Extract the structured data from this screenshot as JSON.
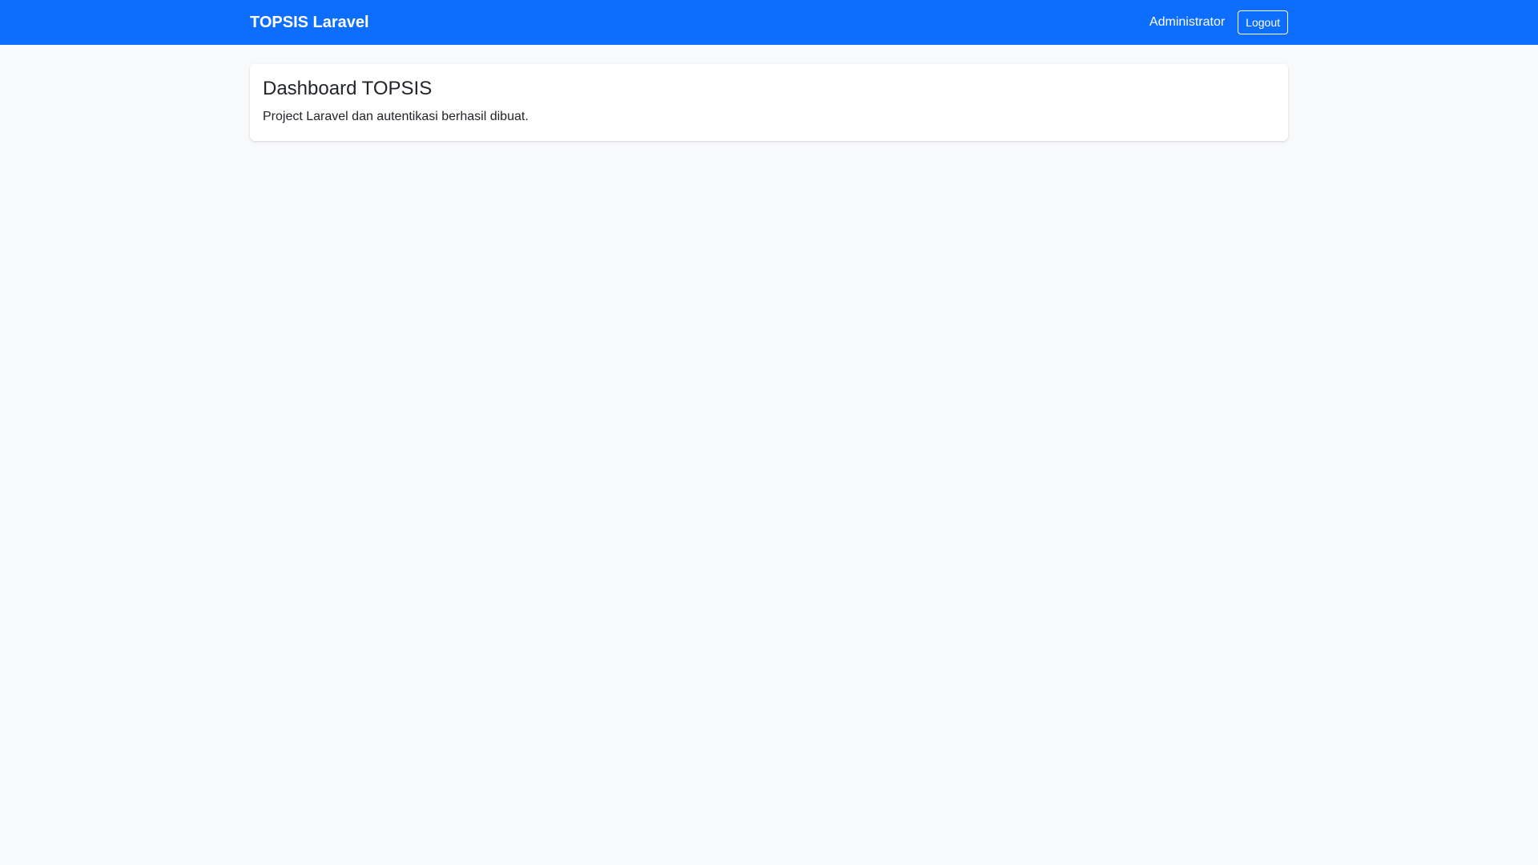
{
  "navbar": {
    "brand": "TOPSIS Laravel",
    "user_name": "Administrator",
    "logout_label": "Logout"
  },
  "dashboard": {
    "title": "Dashboard TOPSIS",
    "message": "Project Laravel dan autentikasi berhasil dibuat."
  },
  "colors": {
    "navbar_bg": "#0d6efd",
    "page_bg": "#f8f9fa",
    "card_bg": "#ffffff",
    "text": "#212529"
  }
}
